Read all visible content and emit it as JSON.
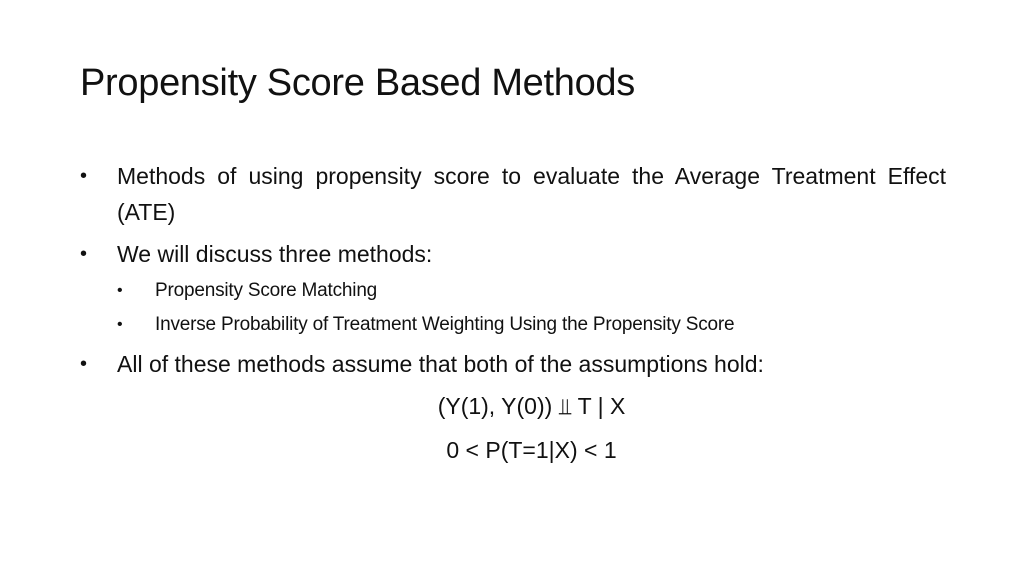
{
  "slide": {
    "title": "Propensity Score Based Methods",
    "bullets": [
      {
        "level": 1,
        "bullet": "•",
        "text": "Methods of using propensity score to evaluate the Average Treatment Effect (ATE)"
      },
      {
        "level": 1,
        "bullet": "•",
        "text": "We will discuss three methods:"
      },
      {
        "level": 2,
        "bullet": "•",
        "text": "Propensity Score Matching"
      },
      {
        "level": 2,
        "bullet": "•",
        "text": "Inverse Probability of Treatment Weighting Using the Propensity Score"
      },
      {
        "level": 1,
        "bullet": "•",
        "text": "All of these methods assume that both of the assumptions hold:"
      }
    ],
    "formulas": [
      "(Y(1), Y(0)) ⫫ T | X",
      "0 < P(T=1|X) < 1"
    ]
  }
}
